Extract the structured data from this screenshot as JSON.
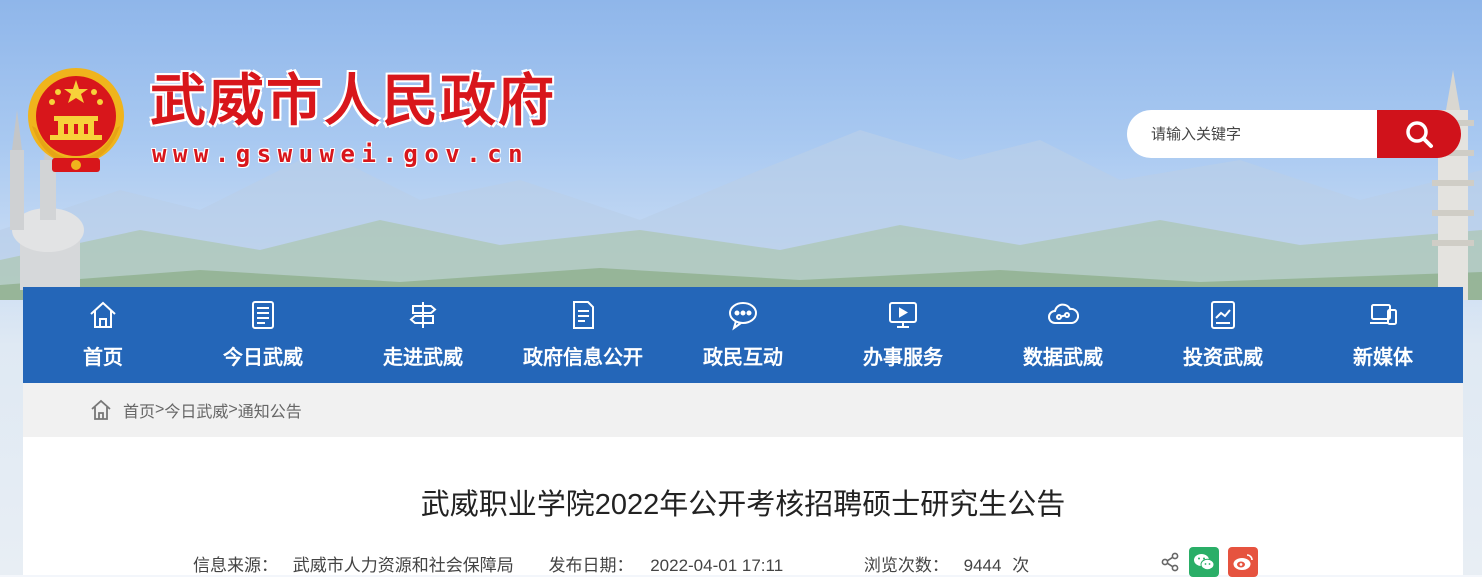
{
  "header": {
    "site_title": "武威市人民政府",
    "site_url": "www.gswuwei.gov.cn",
    "search_placeholder": "请输入关键字"
  },
  "nav": {
    "items": [
      {
        "label": "首页",
        "icon": "home-icon"
      },
      {
        "label": "今日武威",
        "icon": "newspaper-icon"
      },
      {
        "label": "走进武威",
        "icon": "signpost-icon"
      },
      {
        "label": "政府信息公开",
        "icon": "document-icon"
      },
      {
        "label": "政民互动",
        "icon": "chat-icon"
      },
      {
        "label": "办事服务",
        "icon": "monitor-icon"
      },
      {
        "label": "数据武威",
        "icon": "cloud-data-icon"
      },
      {
        "label": "投资武威",
        "icon": "chart-icon"
      },
      {
        "label": "新媒体",
        "icon": "devices-icon"
      }
    ]
  },
  "breadcrumb": {
    "items": [
      "首页",
      "今日武威",
      "通知公告"
    ],
    "separator": ">"
  },
  "article": {
    "title": "武威职业学院2022年公开考核招聘硕士研究生公告",
    "source_label": "信息来源：",
    "source_value": "武威市人力资源和社会保障局",
    "date_label": "发布日期：",
    "date_value": "2022-04-01 17:11",
    "views_label": "浏览次数：",
    "views_value": "9444",
    "views_unit": "次"
  },
  "colors": {
    "brand_red": "#d8161b",
    "nav_blue": "#2466b8",
    "wechat_green": "#2aae67",
    "weibo_red": "#e6533f"
  }
}
